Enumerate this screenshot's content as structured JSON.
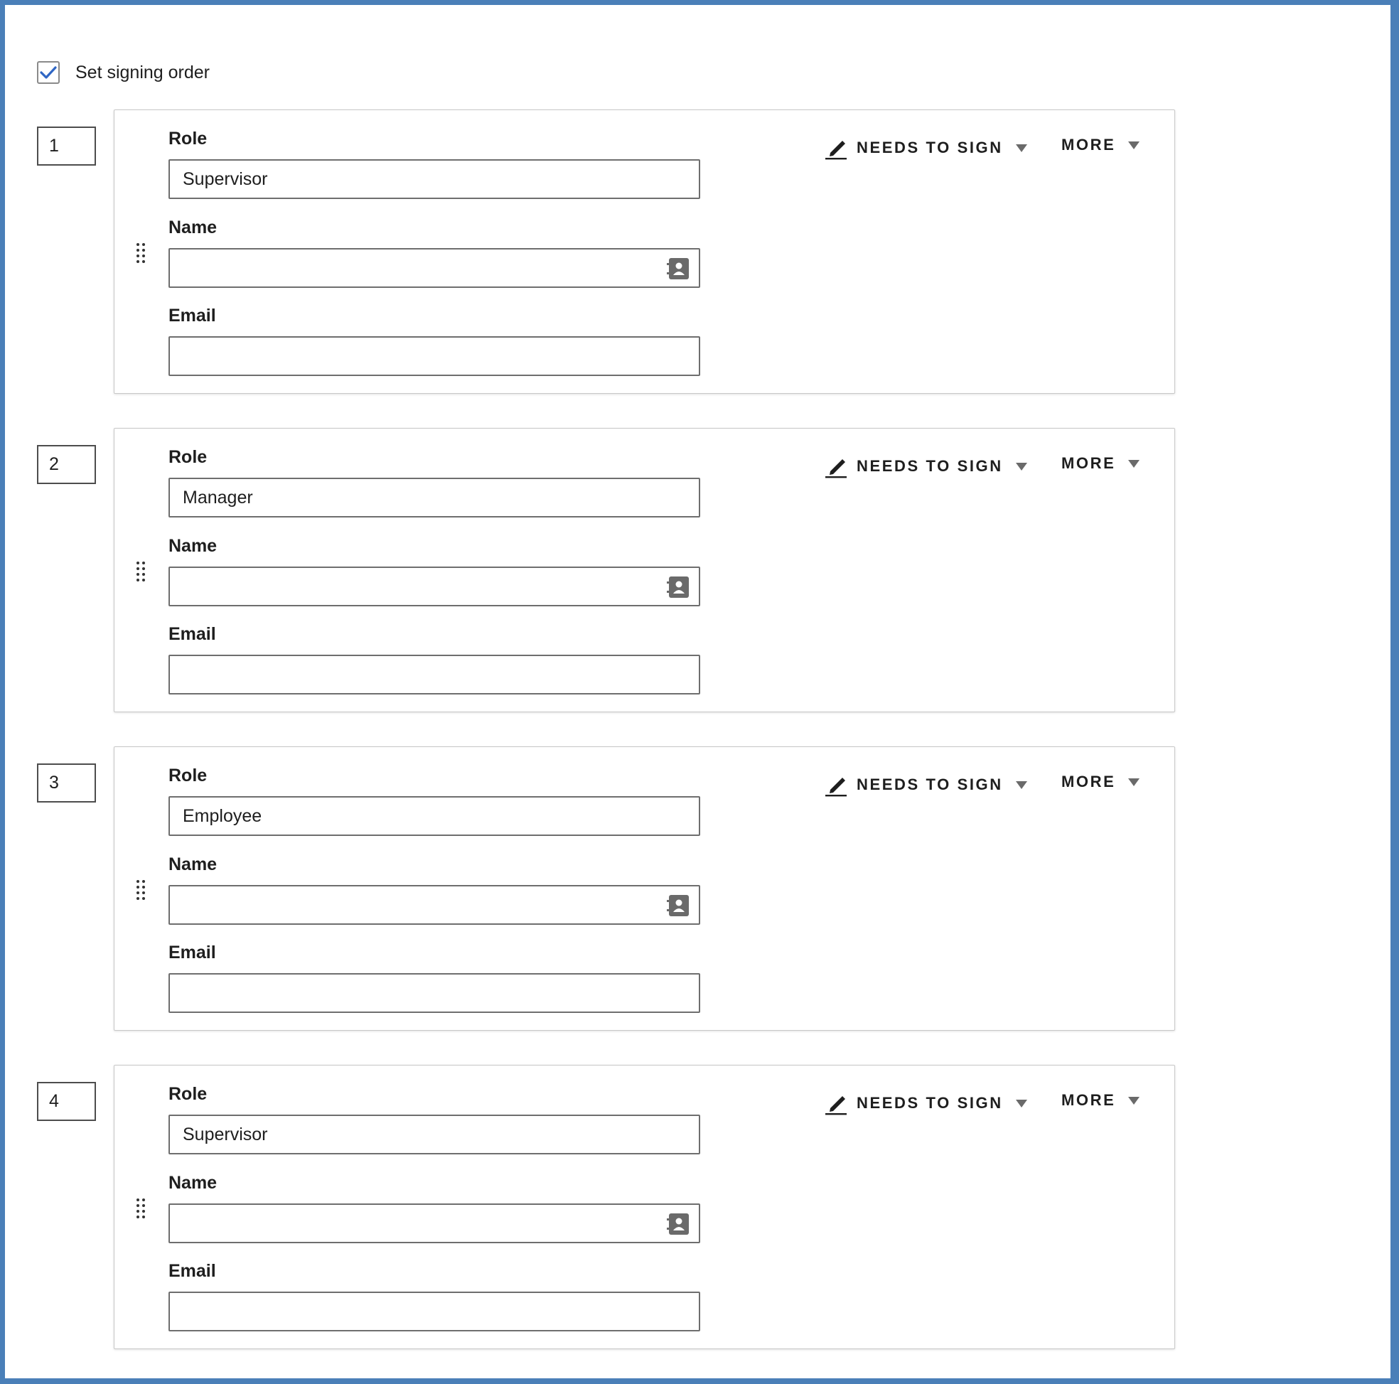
{
  "signing_order": {
    "label": "Set signing order",
    "checked": true
  },
  "labels": {
    "role": "Role",
    "name": "Name",
    "email": "Email"
  },
  "actions": {
    "signer_action": "NEEDS TO SIGN",
    "more": "MORE"
  },
  "icons": {
    "checkbox": "checkmark-icon",
    "drag": "drag-handle-icon",
    "contacts": "address-book-icon",
    "signer": "pen-icon",
    "dropdown": "caret-down-icon"
  },
  "colors": {
    "frame_border": "#4a7fb8",
    "checkmark": "#2f66c4",
    "icon_gray": "#6a6a6a",
    "text": "#1e1e1e"
  },
  "recipients": [
    {
      "order": "1",
      "role": "Supervisor",
      "name": "",
      "email": ""
    },
    {
      "order": "2",
      "role": "Manager",
      "name": "",
      "email": ""
    },
    {
      "order": "3",
      "role": "Employee",
      "name": "",
      "email": ""
    },
    {
      "order": "4",
      "role": "Supervisor",
      "name": "",
      "email": ""
    }
  ]
}
